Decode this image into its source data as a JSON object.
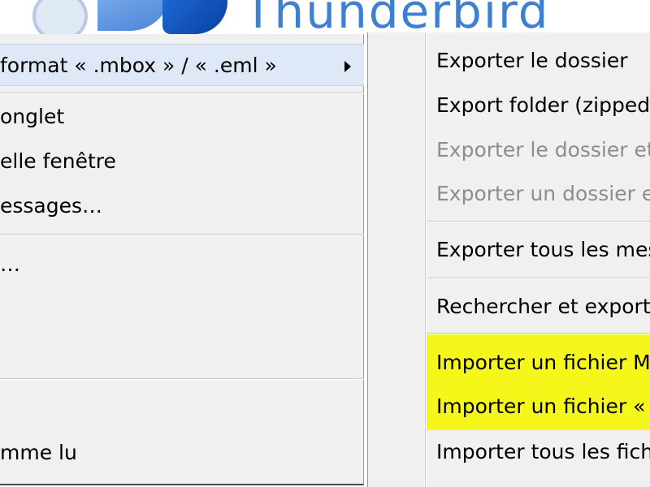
{
  "banner": {
    "text": "Thunderbird"
  },
  "left_menu": {
    "items": [
      {
        "label": "format « .mbox » / « .eml »",
        "has_submenu": true
      },
      {
        "label": "onglet"
      },
      {
        "label": "elle fenêtre"
      },
      {
        "label": "essages…"
      },
      {
        "label": "…"
      },
      {
        "label": "mme lu"
      }
    ]
  },
  "right_menu": {
    "items": [
      {
        "label": "Exporter le dossier",
        "enabled": true
      },
      {
        "label": "Export folder (zipped)",
        "enabled": true
      },
      {
        "label": "Exporter le dossier et",
        "enabled": false
      },
      {
        "label": "Exporter un dossier e",
        "enabled": false
      },
      {
        "label": "Exporter tous les mes",
        "enabled": true
      },
      {
        "label": "Rechercher et exporte",
        "enabled": true
      },
      {
        "label": "Importer un fichier M",
        "enabled": true,
        "highlighted": true
      },
      {
        "label": "Importer un fichier «",
        "enabled": true,
        "highlighted": true
      },
      {
        "label": "Importer tous les fich",
        "enabled": true
      }
    ]
  },
  "colors": {
    "menu_background": "#f0f0f0",
    "highlight": "#f5f71a",
    "disabled_text": "#8d8d8d",
    "hover_row": "#dfe8f6"
  }
}
